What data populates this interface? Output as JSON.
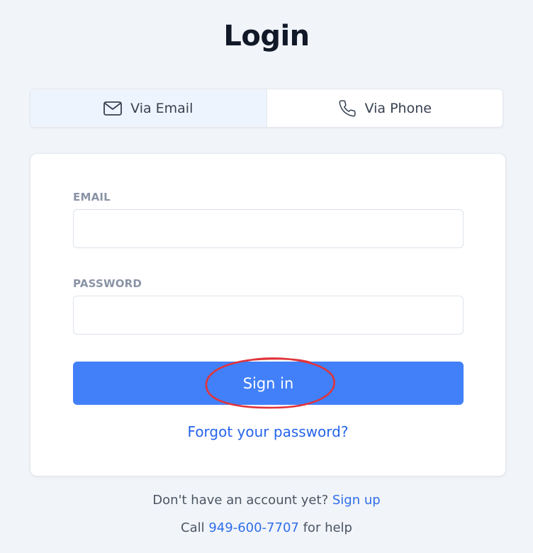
{
  "page": {
    "title": "Login"
  },
  "tabs": [
    {
      "label": "Via Email",
      "icon": "envelope-icon",
      "active": true
    },
    {
      "label": "Via Phone",
      "icon": "phone-icon",
      "active": false
    }
  ],
  "form": {
    "email_label": "EMAIL",
    "email_value": "",
    "password_label": "PASSWORD",
    "password_value": "",
    "submit_label": "Sign in",
    "forgot_label": "Forgot your password?"
  },
  "footer": {
    "signup_prompt": "Don't have an account yet?",
    "signup_link": "Sign up",
    "call_prefix": "Call",
    "phone_number": "949-600-7707",
    "call_suffix": "for help"
  },
  "annotation": {
    "type": "hand-drawn ellipse",
    "target": "sign-in-button",
    "color": "#e0343a"
  },
  "colors": {
    "background": "#f1f4f9",
    "primary": "#4180f9",
    "link": "#2563eb",
    "active_tab": "#eef4fd",
    "label": "#8a94a6"
  }
}
